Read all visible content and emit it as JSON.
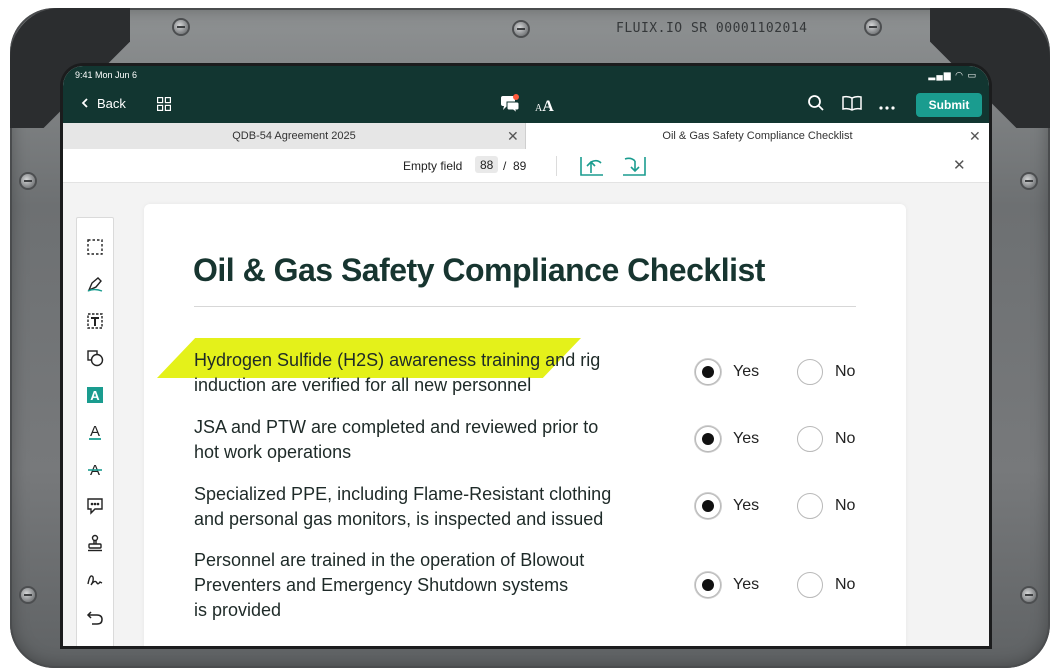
{
  "device": {
    "serial": "FLUIX.IO  SR 00001102014"
  },
  "status_bar": {
    "time": "9:41  Mon Jun 6",
    "icons": "▂▄▆ ◠ ▭"
  },
  "top_bar": {
    "back_label": "Back",
    "submit_label": "Submit",
    "background": "#123631",
    "accent": "#1a9c8f"
  },
  "tabs": [
    {
      "label": "QDB-54 Agreement 2025",
      "active": false
    },
    {
      "label": "Oil & Gas Safety Compliance Checklist",
      "active": true
    }
  ],
  "field_bar": {
    "label": "Empty field",
    "current": "88",
    "separator": "/",
    "total": "89"
  },
  "toolbar": {
    "tools": [
      "selection-icon",
      "pen-icon",
      "text-box-icon",
      "shapes-icon",
      "text-highlight-icon",
      "text-underline-icon",
      "text-strikethrough-icon",
      "comment-icon",
      "stamp-icon",
      "signature-icon",
      "undo-icon"
    ]
  },
  "document": {
    "title": "Oil & Gas Safety Compliance Checklist",
    "questions": [
      {
        "line1": "Hydrogen Sulfide (H2S) awareness training and rig",
        "line2": "induction are verified for all new personnel",
        "line3": "",
        "yes_label": "Yes",
        "no_label": "No",
        "answer": "yes"
      },
      {
        "line1": "JSA and PTW are completed and reviewed prior to",
        "line2": "hot work operations",
        "line3": "",
        "yes_label": "Yes",
        "no_label": "No",
        "answer": "yes"
      },
      {
        "line1": "Specialized PPE, including Flame-Resistant clothing",
        "line2": "and personal gas monitors, is inspected and issued",
        "line3": "",
        "yes_label": "Yes",
        "no_label": "No",
        "answer": "yes"
      },
      {
        "line1": "Personnel are trained in the operation of Blowout",
        "line2": "Preventers and Emergency Shutdown systems",
        "line3": "is provided",
        "yes_label": "Yes",
        "no_label": "No",
        "answer": "yes"
      }
    ],
    "highlight_color": "#e4f11a"
  }
}
